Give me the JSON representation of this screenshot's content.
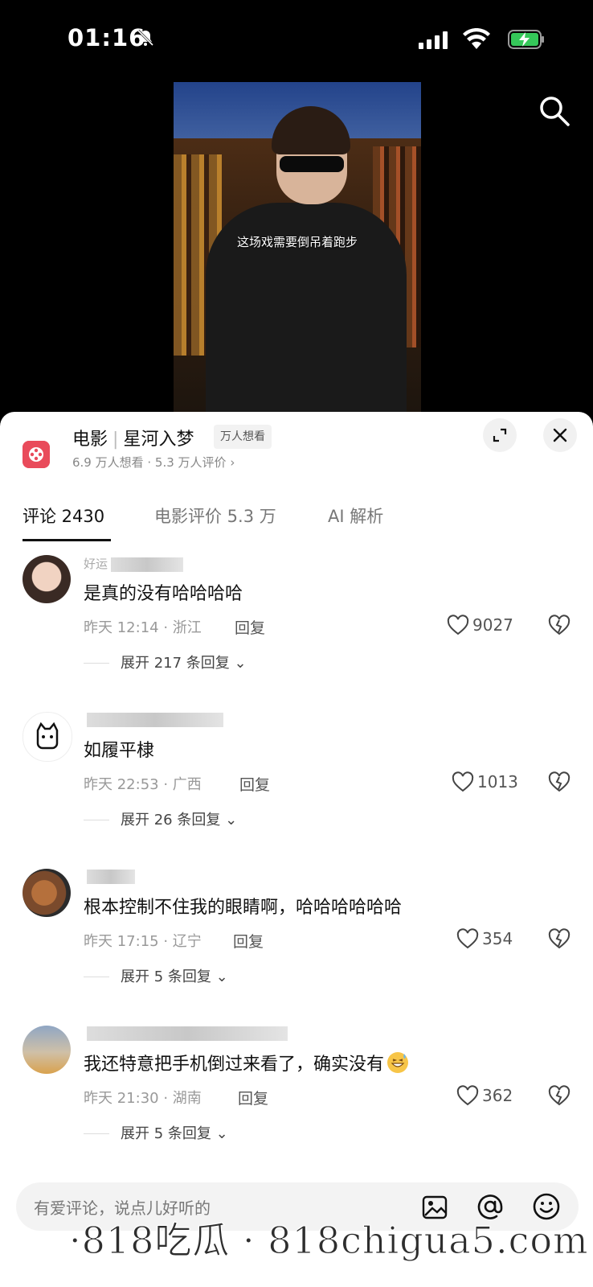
{
  "status_bar": {
    "time": "01:16"
  },
  "video": {
    "caption": "这场戏需要倒吊着跑步"
  },
  "movie": {
    "category": "电影",
    "title": "星河入梦",
    "badge": "万人想看",
    "stats": "6.9 万人想看 · 5.3 万人评价 ›"
  },
  "tabs": [
    {
      "label": "评论 2430",
      "active": true
    },
    {
      "label": "电影评价 5.3 万",
      "active": false
    },
    {
      "label": "AI 解析",
      "active": false
    }
  ],
  "comments": [
    {
      "username": "好运",
      "text": "是真的没有哈哈哈哈",
      "meta": "昨天 12:14 · 浙江",
      "reply": "回复",
      "likes": "9027",
      "expand": "展开 217 条回复 ⌄"
    },
    {
      "username": "",
      "text": "如履平棣",
      "meta": "昨天 22:53 · 广西",
      "reply": "回复",
      "likes": "1013",
      "expand": "展开 26 条回复 ⌄"
    },
    {
      "username": "",
      "text": "根本控制不住我的眼睛啊，哈哈哈哈哈哈",
      "meta": "昨天 17:15 · 辽宁",
      "reply": "回复",
      "likes": "354",
      "expand": "展开 5 条回复 ⌄"
    },
    {
      "username": "",
      "text": "我还特意把手机倒过来看了，确实没有",
      "meta": "昨天 21:30 · 湖南",
      "reply": "回复",
      "likes": "362",
      "expand": "展开 5 条回复 ⌄"
    }
  ],
  "input": {
    "placeholder": "有爱评论，说点儿好听的"
  },
  "watermark": "·818吃瓜 · 818chigua5.com",
  "icons": [
    "bell-off-icon",
    "signal-icon",
    "wifi-icon",
    "battery-charging-icon",
    "search-icon",
    "film-icon",
    "expand-icon",
    "close-icon",
    "heart-icon",
    "broken-heart-icon",
    "image-icon",
    "at-icon",
    "smile-icon"
  ],
  "colors": {
    "accent_red": "#e94b5b",
    "background": "#ffffff",
    "top_bg": "#000000"
  }
}
